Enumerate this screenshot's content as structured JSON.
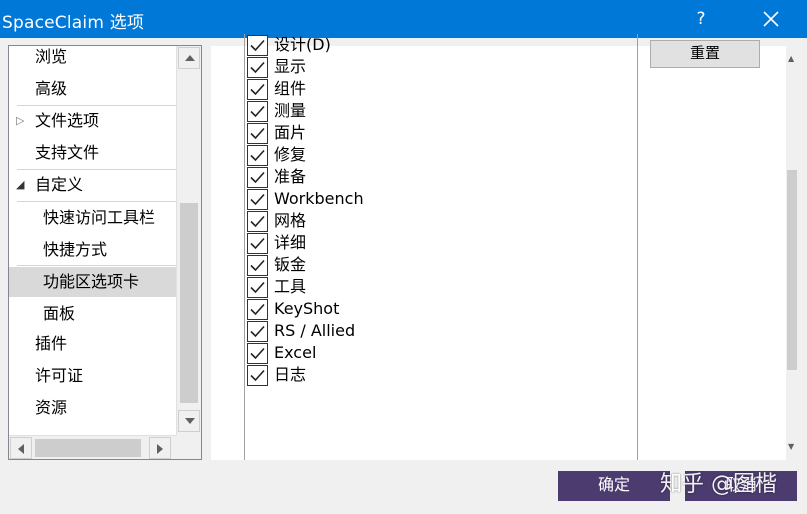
{
  "window": {
    "title": "SpaceClaim 选项",
    "help": "?"
  },
  "tree": {
    "items": [
      {
        "label": "浏览",
        "expander": "",
        "selected": false
      },
      {
        "label": "高级",
        "expander": "",
        "selected": false
      },
      {
        "label": "文件选项",
        "expander": "collapsed",
        "selected": false
      },
      {
        "label": "支持文件",
        "expander": "",
        "selected": false
      },
      {
        "label": "自定义",
        "expander": "expanded",
        "selected": false
      },
      {
        "label": "快速访问工具栏",
        "expander": "",
        "selected": false
      },
      {
        "label": "快捷方式",
        "expander": "",
        "selected": false
      },
      {
        "label": "功能区选项卡",
        "expander": "",
        "selected": true
      },
      {
        "label": "面板",
        "expander": "",
        "selected": false
      },
      {
        "label": "插件",
        "expander": "",
        "selected": false
      },
      {
        "label": "许可证",
        "expander": "",
        "selected": false
      },
      {
        "label": "资源",
        "expander": "",
        "selected": false
      }
    ]
  },
  "ribbon_tabs": {
    "items": [
      {
        "label": "设计(D)",
        "checked": true
      },
      {
        "label": "显示",
        "checked": true
      },
      {
        "label": "组件",
        "checked": true
      },
      {
        "label": "测量",
        "checked": true
      },
      {
        "label": "面片",
        "checked": true
      },
      {
        "label": "修复",
        "checked": true
      },
      {
        "label": "准备",
        "checked": true
      },
      {
        "label": "Workbench",
        "checked": true
      },
      {
        "label": "网格",
        "checked": true
      },
      {
        "label": "详细",
        "checked": true
      },
      {
        "label": "钣金",
        "checked": true
      },
      {
        "label": "工具",
        "checked": true
      },
      {
        "label": "KeyShot",
        "checked": true
      },
      {
        "label": "RS / Allied",
        "checked": true
      },
      {
        "label": "Excel",
        "checked": true
      },
      {
        "label": "日志",
        "checked": true
      }
    ],
    "reset_label": "重置"
  },
  "footer": {
    "ok_label": "确定",
    "cancel_label": "取消",
    "watermark": "知乎 @图楷"
  },
  "colors": {
    "titlebar": "#0078d7",
    "selection": "#d9d9d9",
    "footer_button": "#4b3b6e"
  }
}
